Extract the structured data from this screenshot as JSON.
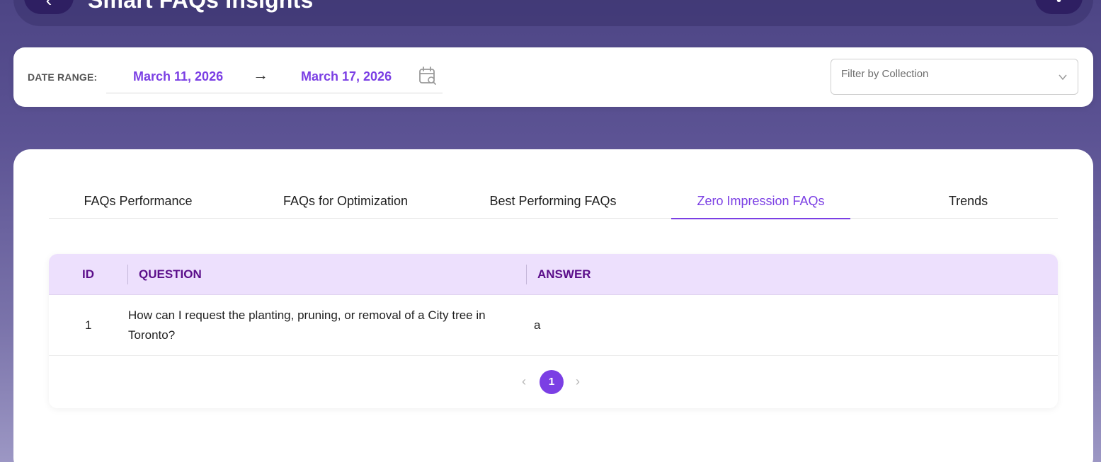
{
  "header": {
    "title": "Smart FAQs Insights",
    "back_icon": "back-icon",
    "user_icon": "user-icon"
  },
  "filters": {
    "date_range_label": "DATE RANGE:",
    "start_date": "March 11, 2026",
    "arrow": "→",
    "end_date": "March 17, 2026",
    "calendar_icon": "calendar-search-icon",
    "collection_placeholder": "Filter by Collection"
  },
  "tabs": [
    {
      "label": "FAQs Performance",
      "active": false
    },
    {
      "label": "FAQs for Optimization",
      "active": false
    },
    {
      "label": "Best Performing FAQs",
      "active": false
    },
    {
      "label": "Zero Impression FAQs",
      "active": true
    },
    {
      "label": "Trends",
      "active": false
    }
  ],
  "table": {
    "columns": [
      "ID",
      "QUESTION",
      "ANSWER"
    ],
    "rows": [
      {
        "id": "1",
        "question": "How can I request the planting, pruning, or removal of a City tree in Toronto?",
        "answer": "a"
      }
    ]
  },
  "pagination": {
    "current_page": "1",
    "prev_symbol": "‹",
    "next_symbol": "›"
  },
  "colors": {
    "accent": "#7b3fe4",
    "header_row_bg": "#ede0fd",
    "header_text": "#5b0e8a"
  }
}
